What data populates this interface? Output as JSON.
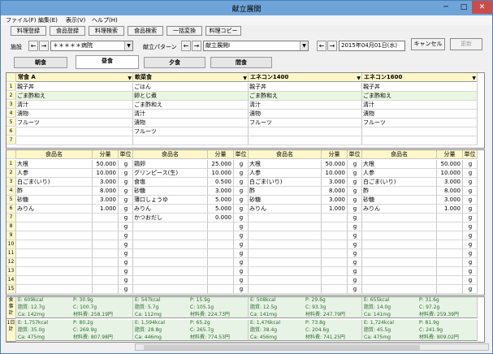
{
  "window": {
    "title": "献立展開",
    "minimize": "─",
    "maximize": "□",
    "close": "✕"
  },
  "menu": [
    "ファイル(F)",
    "編集(E)",
    "表示(V)",
    "ヘルプ(H)"
  ],
  "toolbar": [
    "料理登録",
    "食品登録",
    "料理検索",
    "食品検索",
    "一括変換",
    "料理コピー"
  ],
  "facility_label": "施設",
  "facility_value": "＊＊＊＊＊病院",
  "pattern_label": "献立パターン",
  "pattern_value": "献立展開Ⅰ",
  "date_value": "2015年04月01日(水)",
  "cancel_label": "キャンセル",
  "update_label": "更新",
  "meal_tabs": [
    "朝食",
    "昼食",
    "夕食",
    "間食"
  ],
  "active_tab": 1,
  "columns": [
    {
      "pattern": "常食 A",
      "dishes": [
        "親子丼",
        "ごま酢和え",
        "清汁",
        "漬物",
        "フルーツ"
      ],
      "foods": [
        [
          "大根",
          "50.000",
          "g"
        ],
        [
          "人参",
          "10.000",
          "g"
        ],
        [
          "白ごま(いり)",
          "3.000",
          "g"
        ],
        [
          "酢",
          "8.000",
          "g"
        ],
        [
          "砂糖",
          "3.000",
          "g"
        ],
        [
          "みりん",
          "1.000",
          "g"
        ]
      ],
      "day": {
        "E": "E: 609kcal",
        "P": "P: 30.9g",
        "F": "脂質: 12.7g",
        "C": "C: 100.7g",
        "Ca": "Ca: 142mg",
        "cost": "材料費: 258.19円"
      },
      "total": {
        "E": "E: 1,757kcal",
        "P": "P: 80.2g",
        "F": "脂質: 35.0g",
        "C": "C: 269.9g",
        "Ca": "Ca: 475mg",
        "cost": "材料費: 807.98円"
      }
    },
    {
      "pattern": "軟菜食",
      "dishes": [
        "ごはん",
        "卵とじ煮",
        "ごま酢和え",
        "清汁",
        "漬物",
        "フルーツ"
      ],
      "foods": [
        [
          "鶏卵",
          "25.000",
          "g"
        ],
        [
          "グリンピース(生)",
          "10.000",
          "g"
        ],
        [
          "食塩",
          "0.500",
          "g"
        ],
        [
          "砂糖",
          "3.000",
          "g"
        ],
        [
          "薄口しょうゆ",
          "5.000",
          "g"
        ],
        [
          "みりん",
          "5.000",
          "g"
        ],
        [
          "かつおだし",
          "0.000",
          "g"
        ]
      ],
      "day": {
        "E": "E: 547kcal",
        "P": "P: 15.9g",
        "F": "脂質: 5.7g",
        "C": "C: 105.1g",
        "Ca": "Ca: 112mg",
        "cost": "材料費: 224.73円"
      },
      "total": {
        "E": "E: 1,594kcal",
        "P": "P: 65.2g",
        "F": "脂質: 28.8g",
        "C": "C: 265.7g",
        "Ca": "Ca: 446mg",
        "cost": "材料費: 774.53円"
      }
    },
    {
      "pattern": "エネコン1400",
      "dishes": [
        "親子丼",
        "ごま酢和え",
        "清汁",
        "漬物",
        "フルーツ"
      ],
      "foods": [
        [
          "大根",
          "50.000",
          "g"
        ],
        [
          "人参",
          "10.000",
          "g"
        ],
        [
          "白ごま(いり)",
          "3.000",
          "g"
        ],
        [
          "酢",
          "8.000",
          "g"
        ],
        [
          "砂糖",
          "3.000",
          "g"
        ],
        [
          "みりん",
          "1.000",
          "g"
        ]
      ],
      "day": {
        "E": "E: 508kcal",
        "P": "P: 29.6g",
        "F": "脂質: 12.5g",
        "C": "C: 93.3g",
        "Ca": "Ca: 141mg",
        "cost": "材料費: 247.79円"
      },
      "total": {
        "E": "E: 1,476kcal",
        "P": "P: 73.8g",
        "F": "脂質: 38.4g",
        "C": "C: 204.6g",
        "Ca": "Ca: 456mg",
        "cost": "材料費: 741.25円"
      }
    },
    {
      "pattern": "エネコン1600",
      "dishes": [
        "親子丼",
        "ごま酢和え",
        "清汁",
        "漬物",
        "フルーツ"
      ],
      "foods": [
        [
          "大根",
          "50.000",
          "g"
        ],
        [
          "人参",
          "10.000",
          "g"
        ],
        [
          "白ごま(いり)",
          "3.000",
          "g"
        ],
        [
          "酢",
          "8.000",
          "g"
        ],
        [
          "砂糖",
          "3.000",
          "g"
        ],
        [
          "みりん",
          "1.000",
          "g"
        ]
      ],
      "day": {
        "E": "E: 655kcal",
        "P": "P: 31.6g",
        "F": "脂質: 14.0g",
        "C": "C: 97.2g",
        "Ca": "Ca: 141mg",
        "cost": "材料費: 259.39円"
      },
      "total": {
        "E": "E: 1,724kcal",
        "P": "P: 81.9g",
        "F": "脂質: 45.5g",
        "C": "C: 241.9g",
        "Ca": "Ca: 475mg",
        "cost": "材料費: 809.02円"
      }
    }
  ],
  "food_headers": [
    "食品名",
    "分量",
    "単位"
  ],
  "dish_rows": 7,
  "food_rows": 15,
  "day_label": "食事計",
  "total_label": "1日計"
}
